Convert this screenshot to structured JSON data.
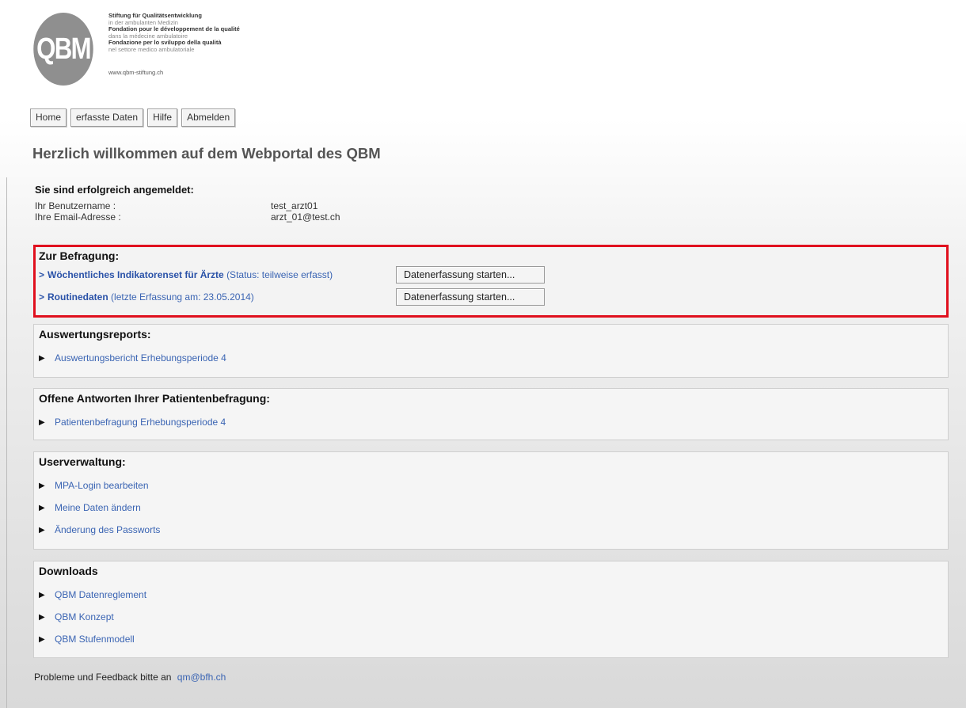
{
  "logo": {
    "mark": "QBM",
    "lines": [
      {
        "text": "Stiftung für Qualitätsentwicklung",
        "style": "b"
      },
      {
        "text": "in der ambulanten Medizin",
        "style": "s"
      },
      {
        "text": "Fondation pour le développement de la qualité",
        "style": "b"
      },
      {
        "text": "dans la médecine ambulatoire",
        "style": "s"
      },
      {
        "text": "Fondazione per lo sviluppo della qualità",
        "style": "b"
      },
      {
        "text": "nel settore medico ambulatoriale",
        "style": "s"
      }
    ],
    "url": "www.qbm-stiftung.ch"
  },
  "nav": {
    "home": "Home",
    "data": "erfasste Daten",
    "help": "Hilfe",
    "logout": "Abmelden"
  },
  "title": "Herzlich willkommen auf dem Webportal des QBM",
  "login": {
    "heading": "Sie sind erfolgreich angemeldet:",
    "username_label": "Ihr Benutzername :",
    "username_value": "test_arzt01",
    "email_label": "Ihre Email-Adresse :",
    "email_value": "arzt_01@test.ch"
  },
  "survey": {
    "title": "Zur Befragung:",
    "items": [
      {
        "marker": ">",
        "name": "Wöchentliches Indikatorenset für Ärzte",
        "status": "(Status: teilweise erfasst)",
        "button": "Datenerfassung starten..."
      },
      {
        "marker": ">",
        "name": "Routinedaten",
        "status": "(letzte Erfassung am: 23.05.2014)",
        "button": "Datenerfassung starten..."
      }
    ]
  },
  "reports": {
    "title": "Auswertungsreports:",
    "items": [
      "Auswertungsbericht Erhebungsperiode 4"
    ]
  },
  "answers": {
    "title": "Offene Antworten Ihrer Patientenbefragung:",
    "items": [
      "Patientenbefragung Erhebungsperiode 4"
    ]
  },
  "users": {
    "title": "Userverwaltung:",
    "items": [
      "MPA-Login bearbeiten",
      "Meine Daten ändern",
      "Änderung des Passworts"
    ]
  },
  "downloads": {
    "title": "Downloads",
    "items": [
      "QBM Datenreglement",
      "QBM Konzept",
      "QBM Stufenmodell"
    ]
  },
  "footer": {
    "text": "Probleme und Feedback bitte an",
    "email": "qm@bfh.ch"
  },
  "icons": {
    "bullet": "triangle-right-icon"
  },
  "colors": {
    "highlight": "#e0101e",
    "link": "#3a64b3",
    "title": "#555555"
  }
}
